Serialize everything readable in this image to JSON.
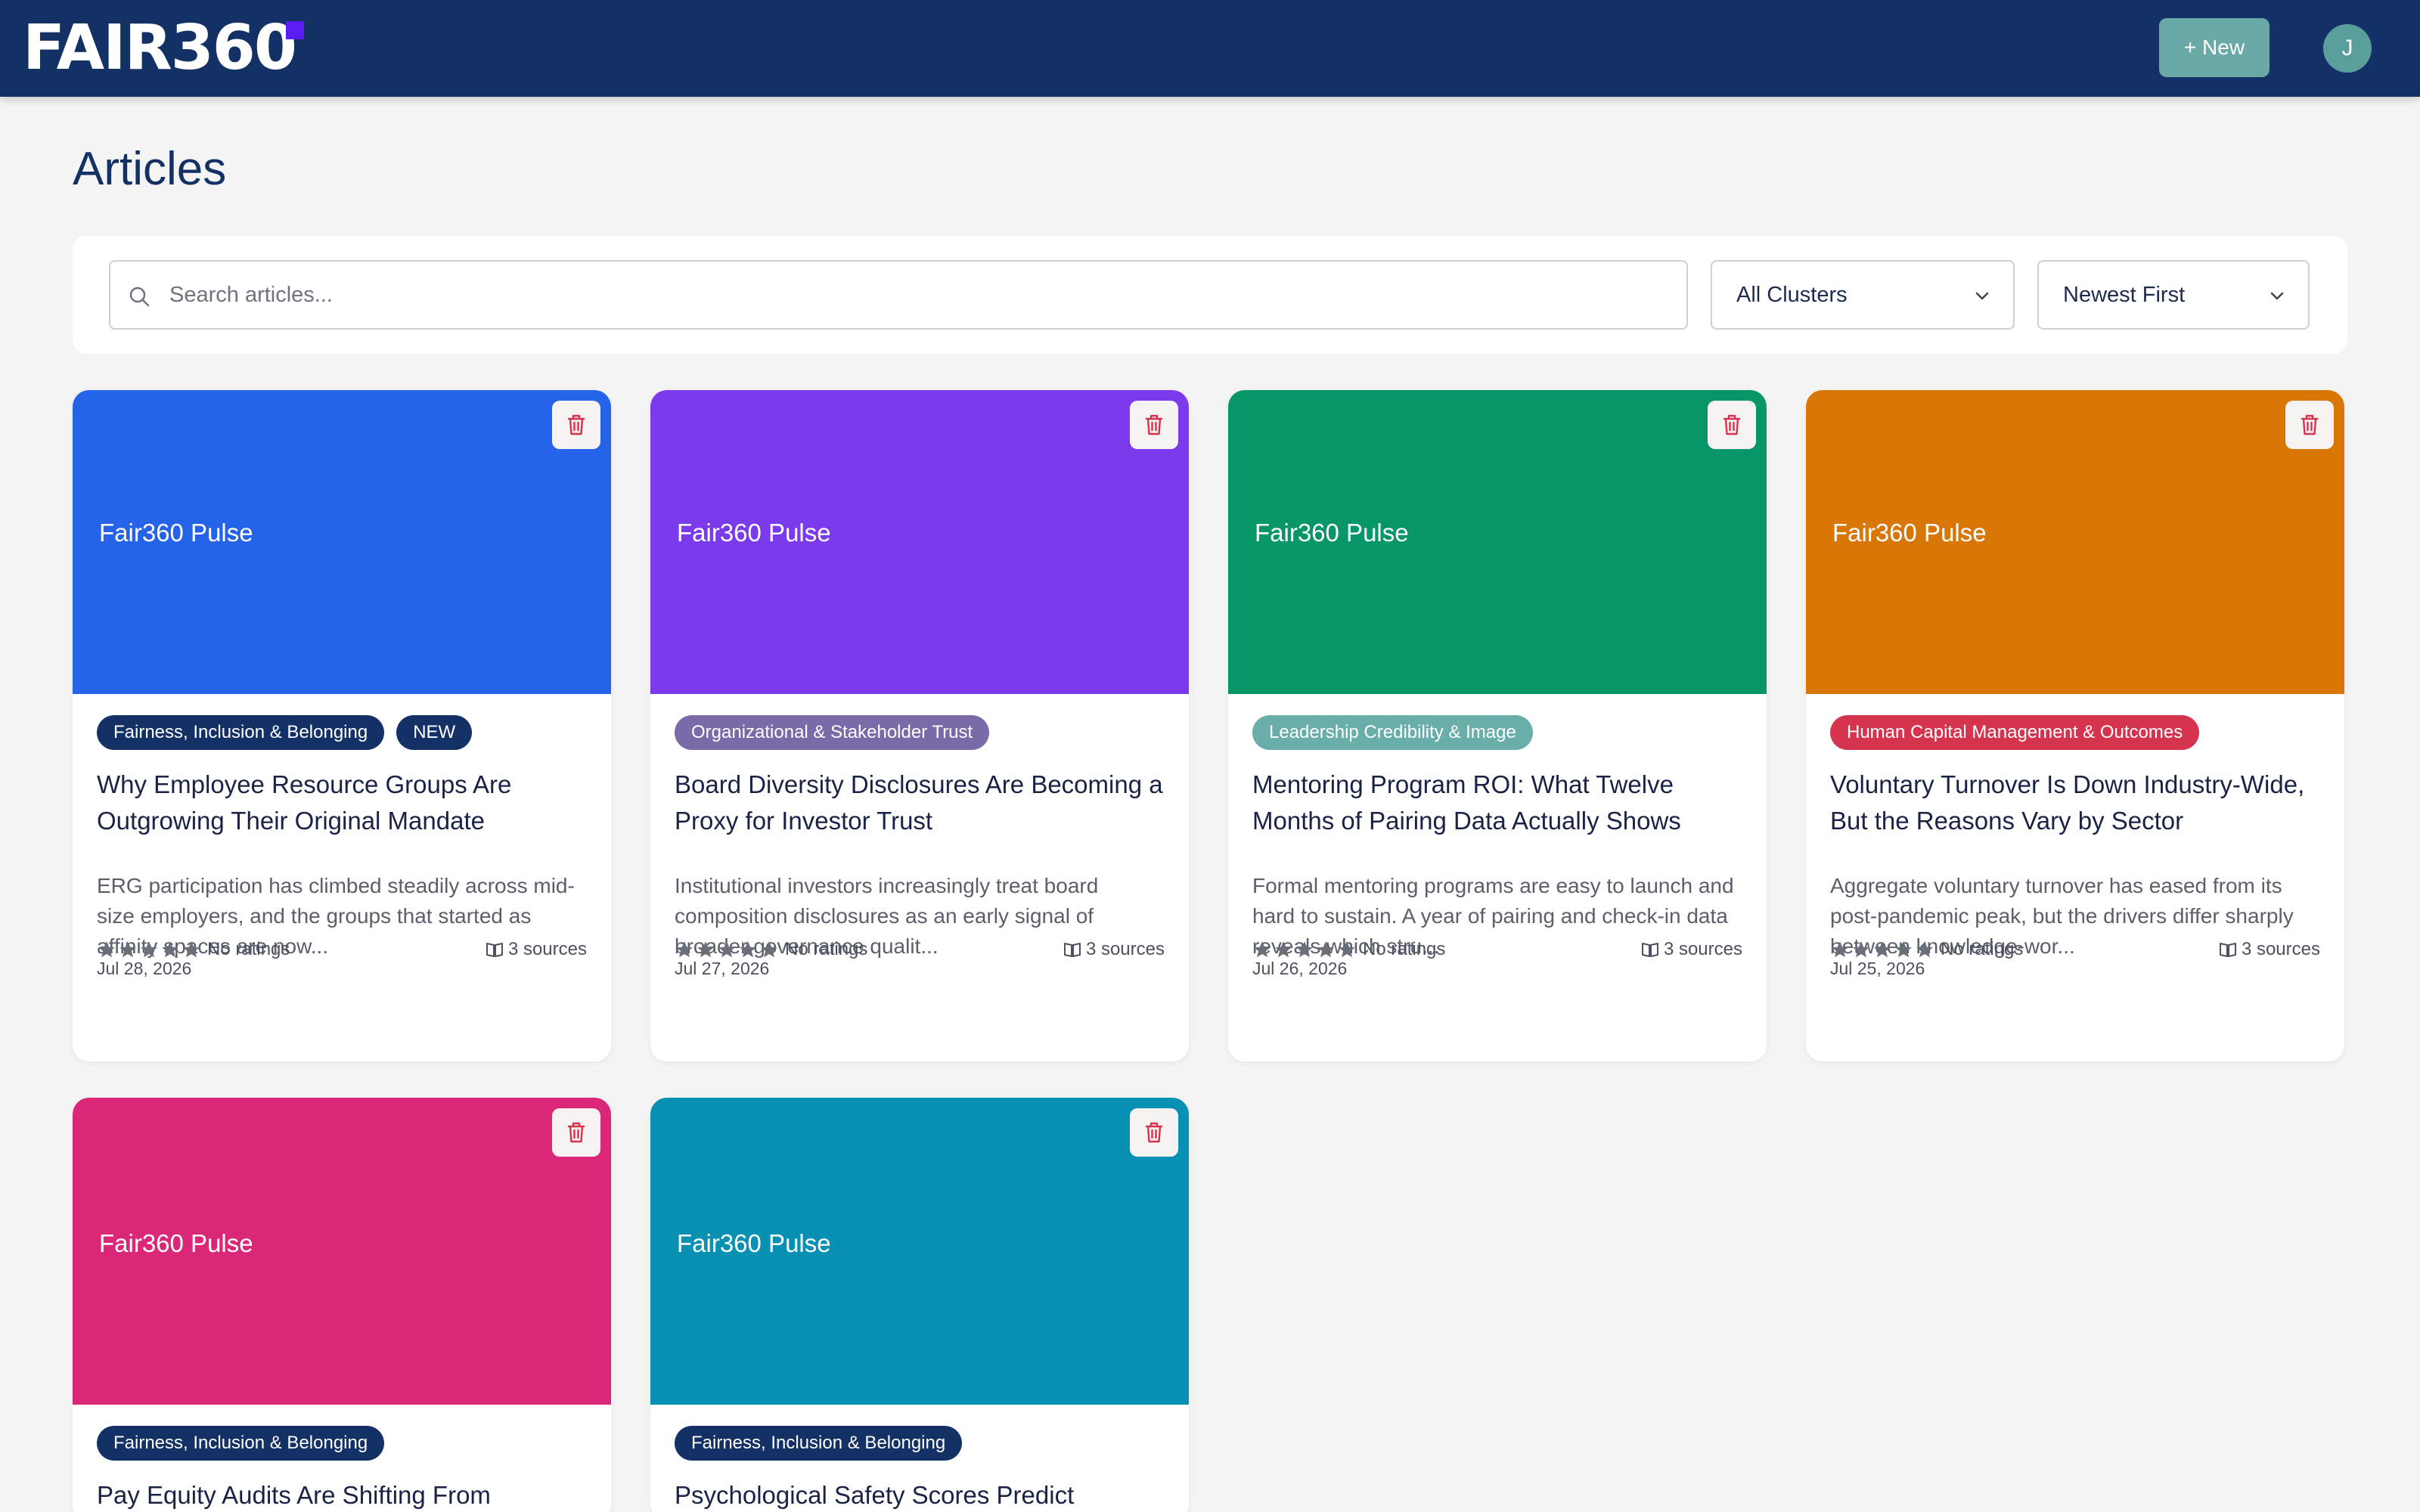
{
  "header": {
    "logo_text": "FAIR360",
    "logo_accent_color": "#5a1cf0",
    "new_button_label": "+ New",
    "avatar_initial": "J"
  },
  "page": {
    "title": "Articles"
  },
  "filters": {
    "search_placeholder": "Search articles...",
    "cluster_select": "All Clusters",
    "sort_select": "Newest First"
  },
  "articles": [
    {
      "hero_color": "#2563e8",
      "hero_label": "Fair360 Pulse",
      "tags": [
        {
          "label": "Fairness, Inclusion & Belonging",
          "color": "#143166"
        },
        {
          "label": "NEW",
          "color": "#143166"
        }
      ],
      "title": "Why Employee Resource Groups Are Outgrowing Their Original Mandate",
      "excerpt": "ERG participation has climbed steadily across mid-size employers, and the groups that started as affinity spaces are now...",
      "rating_text": "No ratings",
      "sources": "3 sources",
      "date": "Jul 28, 2026"
    },
    {
      "hero_color": "#7c3aed",
      "hero_label": "Fair360 Pulse",
      "tags": [
        {
          "label": "Organizational & Stakeholder Trust",
          "color": "#7b6aa8"
        }
      ],
      "title": "Board Diversity Disclosures Are Becoming a Proxy for Investor Trust",
      "excerpt": "Institutional investors increasingly treat board composition disclosures as an early signal of broader governance qualit...",
      "rating_text": "No ratings",
      "sources": "3 sources",
      "date": "Jul 27, 2026"
    },
    {
      "hero_color": "#069669",
      "hero_label": "Fair360 Pulse",
      "tags": [
        {
          "label": "Leadership Credibility & Image",
          "color": "#6aaeaa"
        }
      ],
      "title": "Mentoring Program ROI: What Twelve Months of Pairing Data Actually Shows",
      "excerpt": "Formal mentoring programs are easy to launch and hard to sustain. A year of pairing and check-in data reveals which stru...",
      "rating_text": "No ratings",
      "sources": "3 sources",
      "date": "Jul 26, 2026"
    },
    {
      "hero_color": "#d97706",
      "hero_label": "Fair360 Pulse",
      "tags": [
        {
          "label": "Human Capital Management & Outcomes",
          "color": "#d6334f"
        }
      ],
      "title": "Voluntary Turnover Is Down Industry-Wide, But the Reasons Vary by Sector",
      "excerpt": "Aggregate voluntary turnover has eased from its post-pandemic peak, but the drivers differ sharply between knowledge-wor...",
      "rating_text": "No ratings",
      "sources": "3 sources",
      "date": "Jul 25, 2026"
    },
    {
      "hero_color": "#db2777",
      "hero_label": "Fair360 Pulse",
      "tags": [
        {
          "label": "Fairness, Inclusion & Belonging",
          "color": "#143166"
        }
      ],
      "title": "Pay Equity Audits Are Shifting From",
      "excerpt": "",
      "rating_text": "",
      "sources": "",
      "date": ""
    },
    {
      "hero_color": "#0891b2",
      "hero_label": "Fair360 Pulse",
      "tags": [
        {
          "label": "Fairness, Inclusion & Belonging",
          "color": "#143166"
        }
      ],
      "title": "Psychological Safety Scores Predict",
      "excerpt": "",
      "rating_text": "",
      "sources": "",
      "date": ""
    }
  ]
}
